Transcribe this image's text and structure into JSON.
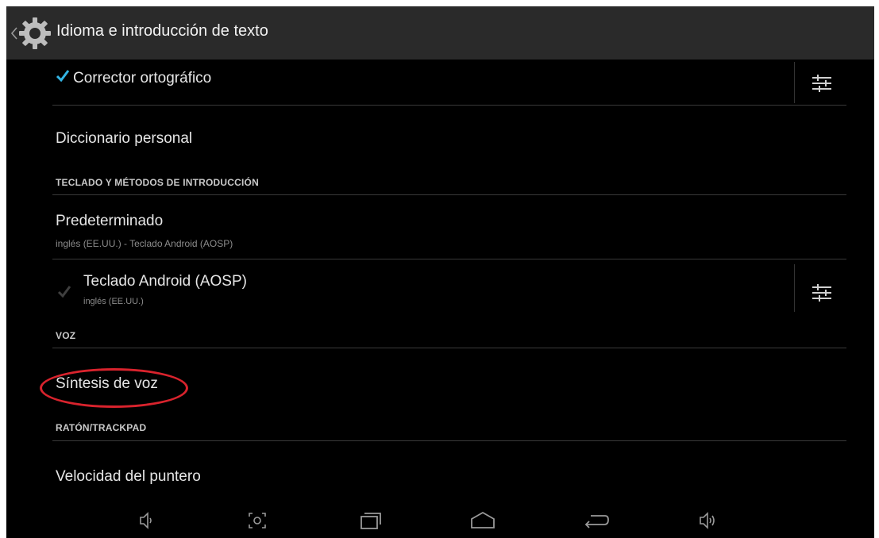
{
  "actionbar": {
    "title": "Idioma e introducción de texto",
    "icon": "settings-gear-icon"
  },
  "rows": {
    "spell_checker": {
      "label": "Corrector ortográfico",
      "checked": true
    },
    "personal_dictionary": {
      "label": "Diccionario personal"
    },
    "keyboard_section": {
      "label": "TECLADO Y MÉTODOS DE INTRODUCCIÓN"
    },
    "default_ime": {
      "label": "Predeterminado",
      "summary": "inglés (EE.UU.) - Teclado Android (AOSP)"
    },
    "android_keyboard": {
      "label": "Teclado Android (AOSP)",
      "summary": "inglés (EE.UU.)",
      "checked": true
    },
    "voice_section": {
      "label": "VOZ"
    },
    "tts": {
      "label": "Síntesis de voz"
    },
    "mouse_section": {
      "label": "RATÓN/TRACKPAD"
    },
    "pointer_speed": {
      "label": "Velocidad del puntero"
    }
  },
  "navbar": {
    "buttons": [
      "volume-down-icon",
      "screenshot-icon",
      "recent-apps-icon",
      "home-icon",
      "back-icon",
      "volume-up-icon"
    ]
  },
  "colors": {
    "background": "#000000",
    "actionbar": "#2a2a2a",
    "accent_check": "#33b5e5",
    "highlight": "#d9232d"
  }
}
